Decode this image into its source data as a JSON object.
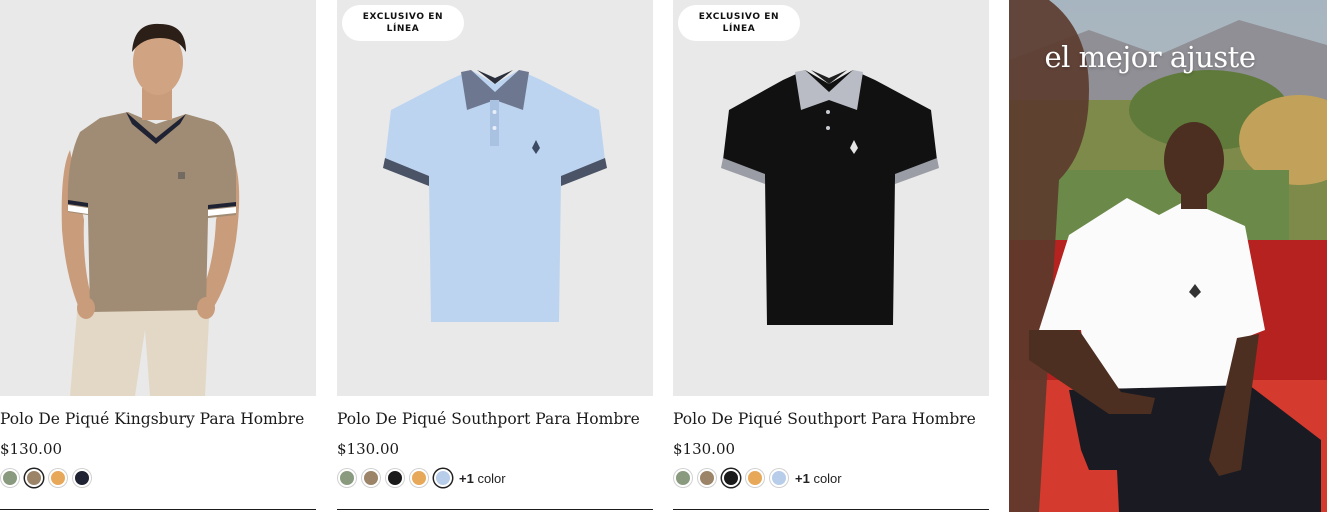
{
  "products": [
    {
      "title": "Polo De Piqué Kingsbury Para Hombre",
      "price": "$130.00",
      "badge": null,
      "swatches": [
        {
          "name": "sage",
          "color": "#8a9a7e",
          "selected": false
        },
        {
          "name": "khaki",
          "color": "#9c8468",
          "selected": true
        },
        {
          "name": "orange",
          "color": "#e7a85a",
          "selected": false
        },
        {
          "name": "navy",
          "color": "#1f2233",
          "selected": false
        }
      ],
      "more_colors": ""
    },
    {
      "title": "Polo De Piqué Southport Para Hombre",
      "price": "$130.00",
      "badge": {
        "line1": "EXCLUSIVO EN",
        "line2": "LÍNEA"
      },
      "swatches": [
        {
          "name": "sage",
          "color": "#8a9a7e",
          "selected": false
        },
        {
          "name": "khaki",
          "color": "#9c8468",
          "selected": false
        },
        {
          "name": "black",
          "color": "#1a1a1a",
          "selected": false
        },
        {
          "name": "orange",
          "color": "#e7a85a",
          "selected": false
        },
        {
          "name": "light-blue",
          "color": "#b7cde9",
          "selected": true
        }
      ],
      "more_colors": "+1 color"
    },
    {
      "title": "Polo De Piqué Southport Para Hombre",
      "price": "$130.00",
      "badge": {
        "line1": "EXCLUSIVO EN",
        "line2": "LÍNEA"
      },
      "swatches": [
        {
          "name": "sage",
          "color": "#8a9a7e",
          "selected": false
        },
        {
          "name": "khaki",
          "color": "#9c8468",
          "selected": false
        },
        {
          "name": "black",
          "color": "#1a1a1a",
          "selected": true
        },
        {
          "name": "orange",
          "color": "#e7a85a",
          "selected": false
        },
        {
          "name": "light-blue",
          "color": "#b7cde9",
          "selected": false
        }
      ],
      "more_colors": "+1 color"
    }
  ],
  "promo": {
    "title": "el mejor ajuste"
  },
  "colors": {
    "image_bg": "#e9e9e9",
    "text": "#1b1b1b",
    "tan_polo": "#a08b74",
    "light_blue_polo": "#bcd4ef",
    "black_polo": "#111111",
    "collar_gray": "#5d6680"
  }
}
